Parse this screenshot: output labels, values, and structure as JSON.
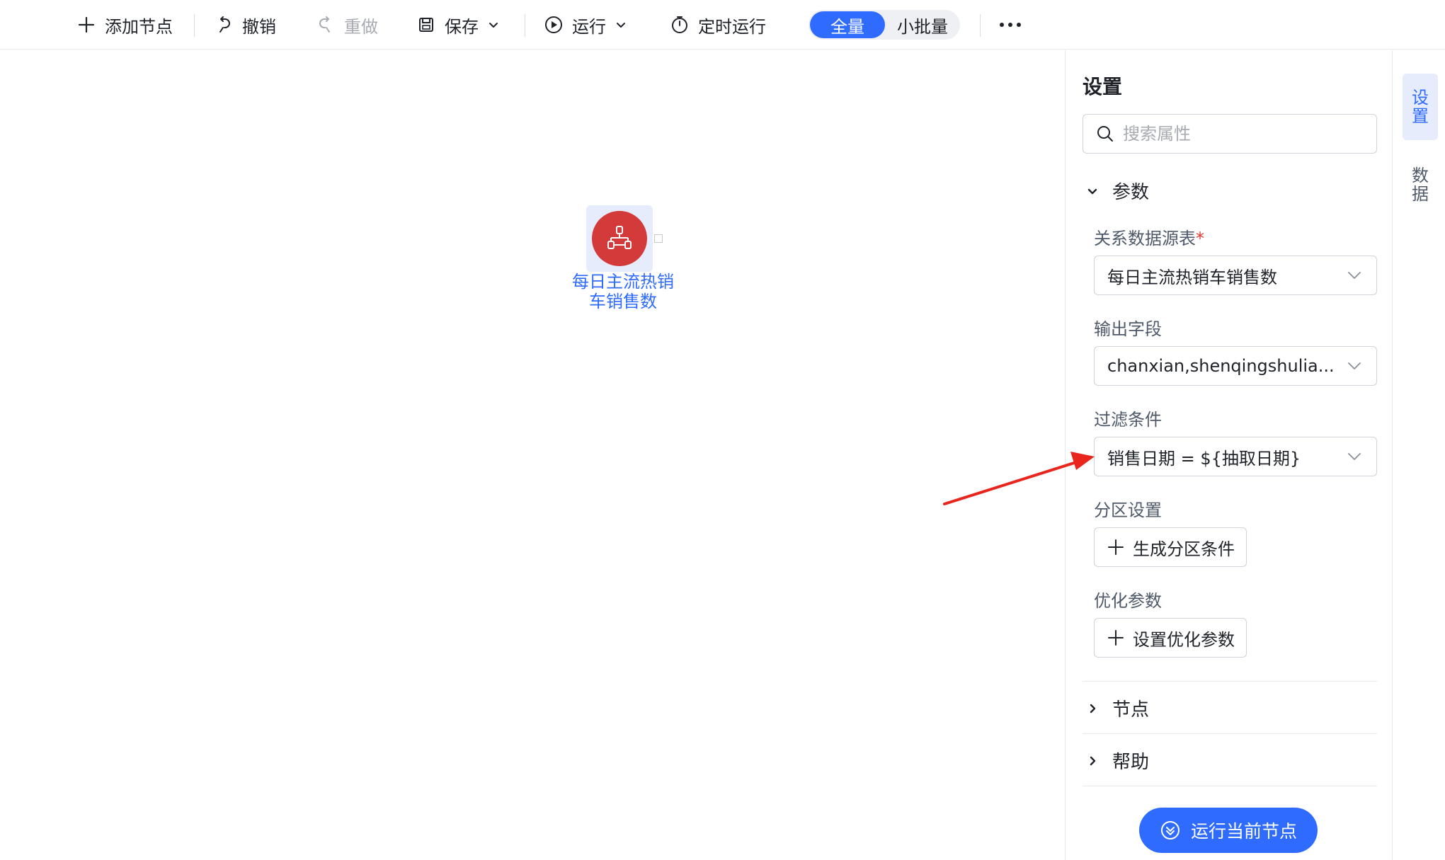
{
  "toolbar": {
    "add_node": "添加节点",
    "undo": "撤销",
    "redo": "重做",
    "save": "保存",
    "run": "运行",
    "scheduled_run": "定时运行",
    "mode_full": "全量",
    "mode_small": "小批量"
  },
  "canvas": {
    "node_label_line1": "每日主流热销",
    "node_label_line2": "车销售数"
  },
  "panel": {
    "title": "设置",
    "search_placeholder": "搜索属性",
    "section_params": "参数",
    "field_source_label": "关系数据源表",
    "field_source_required": "*",
    "field_source_value": "每日主流热销车销售数",
    "field_output_label": "输出字段",
    "field_output_value": "chanxian,shenqingshulia...",
    "field_filter_label": "过滤条件",
    "field_filter_value": "销售日期 = ${抽取日期}",
    "field_partition_label": "分区设置",
    "btn_partition": "生成分区条件",
    "field_optimize_label": "优化参数",
    "btn_optimize": "设置优化参数",
    "section_node": "节点",
    "section_help": "帮助",
    "run_current": "运行当前节点"
  },
  "side_tabs": {
    "settings_1": "设",
    "settings_2": "置",
    "data_1": "数",
    "data_2": "据"
  },
  "colors": {
    "primary": "#2f6bff",
    "node_red": "#d33a3a",
    "arrow_red": "#e8261e"
  }
}
